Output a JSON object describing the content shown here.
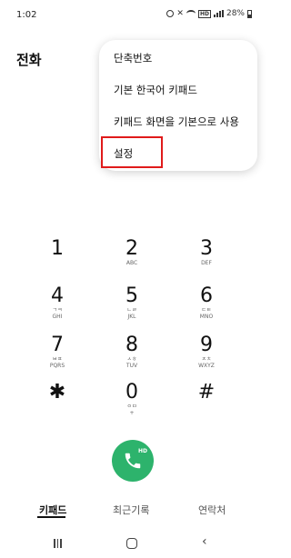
{
  "status_bar": {
    "time": "1:02",
    "battery": "28%",
    "icons": [
      "alarm-icon",
      "mute-icon",
      "wifi-icon",
      "hd-icon",
      "signal-icon",
      "battery-icon"
    ]
  },
  "header": {
    "title": "전화"
  },
  "menu": {
    "items": [
      {
        "label": "단축번호"
      },
      {
        "label": "기본 한국어 키패드"
      },
      {
        "label": "키패드 화면을 기본으로 사용"
      },
      {
        "label": "설정"
      }
    ],
    "highlight_color": "#e01b1b"
  },
  "keypad": {
    "keys": [
      {
        "digit": "1",
        "sub1": "",
        "sub2": ""
      },
      {
        "digit": "2",
        "sub1": "",
        "sub2": "ABC"
      },
      {
        "digit": "3",
        "sub1": "",
        "sub2": "DEF"
      },
      {
        "digit": "4",
        "sub1": "ㄱㅋ",
        "sub2": "GHI"
      },
      {
        "digit": "5",
        "sub1": "ㄴㄹ",
        "sub2": "JKL"
      },
      {
        "digit": "6",
        "sub1": "ㄷㅌ",
        "sub2": "MNO"
      },
      {
        "digit": "7",
        "sub1": "ㅂㅍ",
        "sub2": "PQRS"
      },
      {
        "digit": "8",
        "sub1": "ㅅㅎ",
        "sub2": "TUV"
      },
      {
        "digit": "9",
        "sub1": "ㅈㅊ",
        "sub2": "WXYZ"
      },
      {
        "digit": "✱",
        "sub1": "",
        "sub2": ""
      },
      {
        "digit": "0",
        "sub1": "ㅇㅁ",
        "sub2": "+"
      },
      {
        "digit": "#",
        "sub1": "",
        "sub2": ""
      }
    ]
  },
  "call_button": {
    "badge": "HD",
    "color": "#2db36c"
  },
  "tabs": [
    {
      "label": "키패드"
    },
    {
      "label": "최근기록"
    },
    {
      "label": "연락처"
    }
  ],
  "nav_icons": [
    "recent-apps-icon",
    "home-icon",
    "back-icon"
  ]
}
